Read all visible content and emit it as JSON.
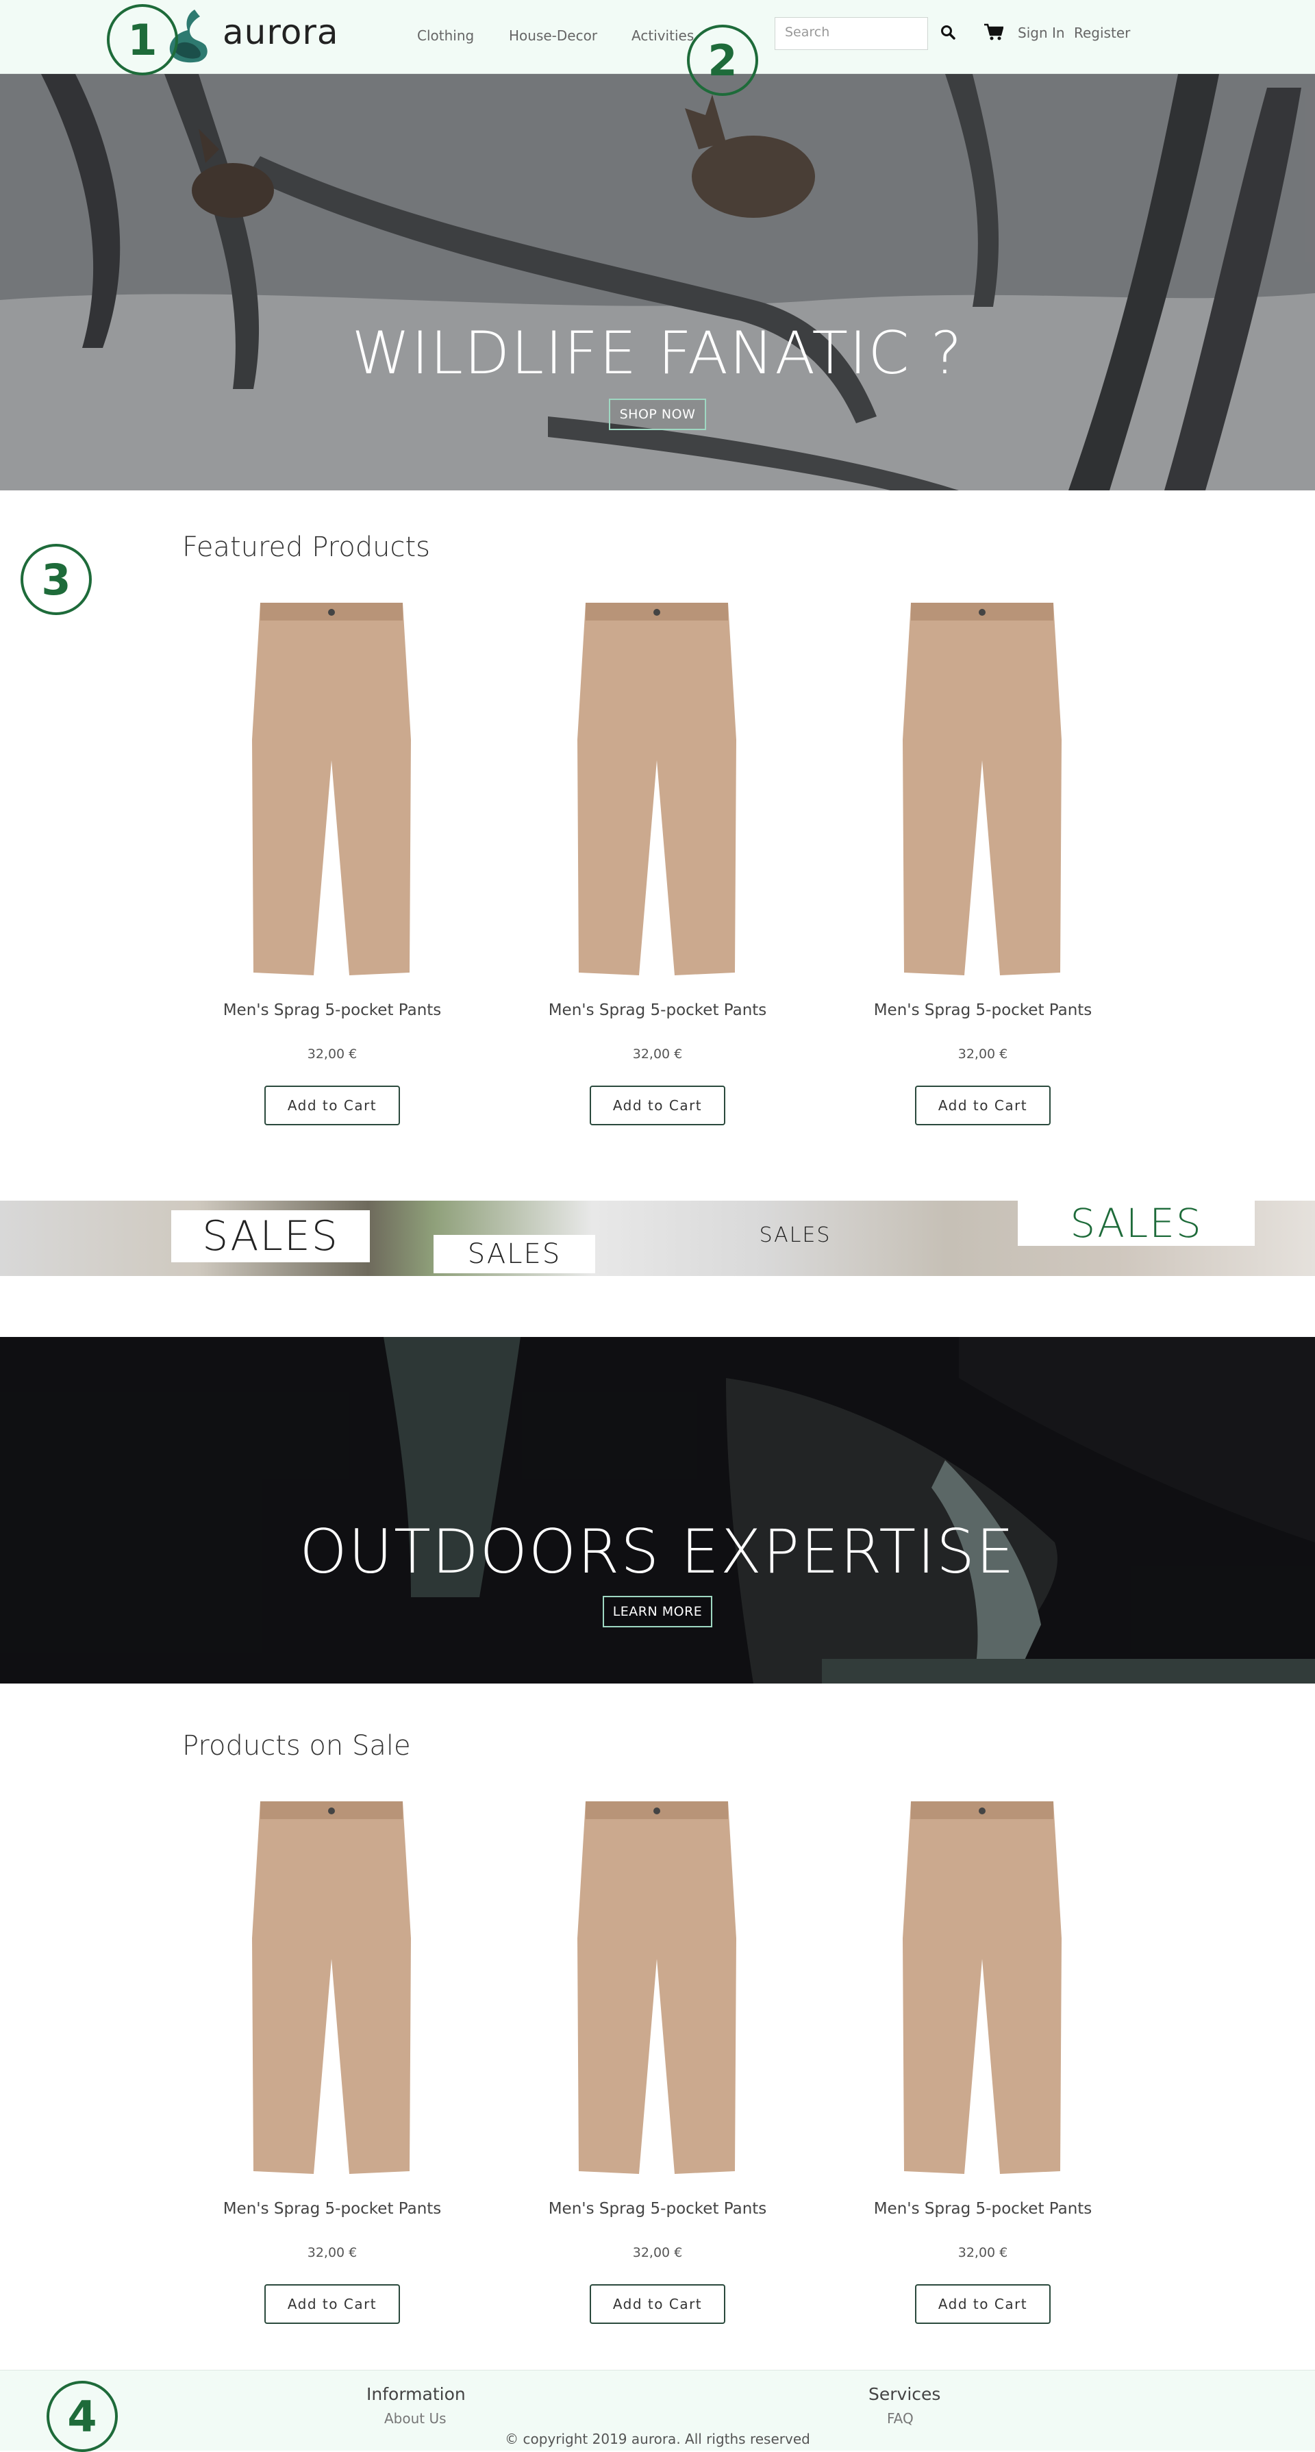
{
  "header": {
    "logo_text": "aurora",
    "nav": [
      "Clothing",
      "House-Decor",
      "Activities"
    ],
    "search_placeholder": "Search",
    "sign_in": "Sign In",
    "register": "Register"
  },
  "badges": [
    "1",
    "2",
    "3",
    "4"
  ],
  "hero1": {
    "title": "WILDLIFE FANATIC ?",
    "button": "SHOP NOW"
  },
  "featured": {
    "title": "Featured Products",
    "products": [
      {
        "name": "Men's Sprag 5-pocket Pants",
        "price": "32,00 €",
        "button": "Add to Cart"
      },
      {
        "name": "Men's Sprag 5-pocket Pants",
        "price": "32,00 €",
        "button": "Add to Cart"
      },
      {
        "name": "Men's Sprag 5-pocket Pants",
        "price": "32,00 €",
        "button": "Add to Cart"
      }
    ]
  },
  "sales_banner": {
    "tags": [
      "SALES",
      "SALES",
      "SALES",
      "SALES"
    ],
    "accent": "#1e6b3a"
  },
  "hero2": {
    "title": "OUTDOORS EXPERTISE",
    "button": "LEARN MORE"
  },
  "on_sale": {
    "title": "Products on Sale",
    "products": [
      {
        "name": "Men's Sprag 5-pocket Pants",
        "price": "32,00 €",
        "button": "Add to Cart"
      },
      {
        "name": "Men's Sprag 5-pocket Pants",
        "price": "32,00 €",
        "button": "Add to Cart"
      },
      {
        "name": "Men's Sprag 5-pocket Pants",
        "price": "32,00 €",
        "button": "Add to Cart"
      }
    ]
  },
  "footer": {
    "information": {
      "title": "Information",
      "link": "About Us"
    },
    "services": {
      "title": "Services",
      "link": "FAQ"
    },
    "copyright": "copyright 2019 aurora. All rigths reserved"
  },
  "colors": {
    "brand_green": "#1e6b3a",
    "header_bg": "#f2fbf6",
    "button_border": "#2b4a3d"
  }
}
